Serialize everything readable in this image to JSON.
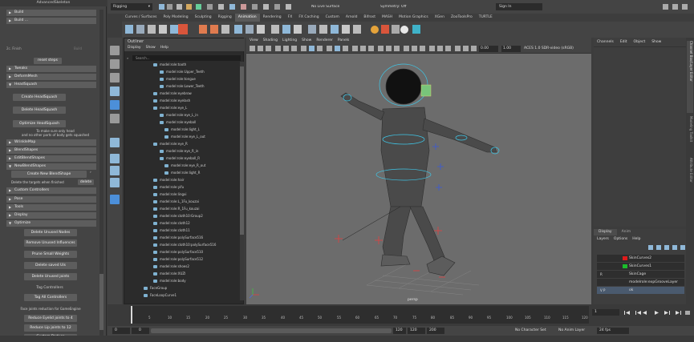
{
  "app": {
    "panel_title": "AdvancedSkeleton"
  },
  "left_panel": {
    "header_sections": [
      "Build",
      "Build ..."
    ],
    "fit_label": "2c. Finish",
    "build_label": "Build",
    "reset_steps": "reset steps",
    "sections": [
      "Tweaks",
      "DeformMesh",
      "HeadSquash"
    ],
    "head_buttons": [
      "Create HeadSquash",
      "Delete HeadSquash",
      "Optimize HeadSquash"
    ],
    "head_note_1": "To make sure only head",
    "head_note_2": "and no other parts of body gets squashed",
    "sections_2": [
      "WrinkleMap",
      "BlendShapes",
      "EditBlendShapes",
      "NewBlendShapes"
    ],
    "new_blendshape_button": "Create New BlendShape",
    "delete_targets_label": "Delete the targets when finished",
    "delete_btn": "delete",
    "custom_controllers": "Custom Controllers",
    "sections_3": [
      "Pose",
      "Tools",
      "Display",
      "Optimize"
    ],
    "optimize_buttons": [
      "Delete Unused Nodes",
      "Remove Unused Influences",
      "Prune Small Weights",
      "Delete saved UIs",
      "Delete Unused joints"
    ],
    "tag_controllers_label": "Tag Controllers",
    "tag_all_button": "Tag All Controllers",
    "reduce_label": "Face joints reduction for GameEngine",
    "reduce_buttons": [
      "Reduce Eyelid joints to 4",
      "Reduce Lip joints to 12",
      "Custom Reduce"
    ]
  },
  "topbar": {
    "workspace": "Rigging",
    "live_surface": "No Live Surface",
    "symmetry": "Symmetry: Off",
    "sign_in": "Sign In"
  },
  "shelf_tabs": [
    "Curves / Surfaces",
    "Poly Modeling",
    "Sculpting",
    "Rigging",
    "Animation",
    "Rendering",
    "FX",
    "FX Caching",
    "Custom",
    "Arnold",
    "Bifrost",
    "MASH",
    "Motion Graphics",
    "XGen",
    "ZooToolsPro",
    "TURTLE"
  ],
  "shelf_active": "Animation",
  "outliner": {
    "title": "Outliner",
    "menus": [
      "Display",
      "Show",
      "Help"
    ],
    "search_placeholder": "Search...",
    "items": [
      "model:role:tooth",
      "model:role:Upper_Teeth",
      "model:role:tongue",
      "model:role:Lower_Teeth",
      "model:role:eyebrow",
      "model:role:eyelash",
      "model:role:eye_L",
      "model:role:eye_L_in",
      "model:role:eyeball",
      "model:role:light_L",
      "model:role:eye_L_out",
      "model:role:eye_R",
      "model:role:eye_R_in",
      "model:role:eyeball_R",
      "model:role:eye_R_out",
      "model:role:light_R",
      "model:role:hair",
      "model:role:yifu",
      "model:role:lingxi",
      "model:role:L_1Fu_kouzai",
      "model:role:R_1Fu_kouzai",
      "model:role:cloth10:Group2",
      "model:role:cloth12",
      "model:role:cloth11",
      "model:role:polySurface516",
      "model:role:cloth10:polySurface516",
      "model:role:polySurface510",
      "model:role:polySurface512",
      "model:role:shoes2",
      "model:role:XUZI",
      "model:role:body",
      "FaceGroup",
      "FaceLoopCurve1"
    ]
  },
  "viewport": {
    "menus": [
      "View",
      "Shading",
      "Lighting",
      "Show",
      "Renderer",
      "Panels"
    ],
    "frame_a": "0.00",
    "frame_b": "1.00",
    "color_space": "ACES 1.0 SDR-video (sRGB)",
    "camera_label": "persp"
  },
  "channels": {
    "menus": [
      "Channels",
      "Edit",
      "Object",
      "Show"
    ]
  },
  "side_tabs": [
    "Channel Box/Layer Editor",
    "Modeling Toolkit",
    "Attribute Editor"
  ],
  "layers": {
    "tabs": [
      "Display",
      "Anim"
    ],
    "menus": [
      "Layers",
      "Options",
      "Help"
    ],
    "rows": [
      {
        "name": "SkinCurves2",
        "color": "#e01b1b",
        "flag": ""
      },
      {
        "name": "SkinCurves1",
        "color": "#1bbd2b",
        "flag": ""
      },
      {
        "name": "SkinCage",
        "color": "",
        "flag": "R"
      },
      {
        "name": "modelrole:expGrooveLayer",
        "color": "",
        "flag": ""
      },
      {
        "name": "ok",
        "color": "",
        "flag": "V P"
      }
    ]
  },
  "timeline": {
    "ticks": [
      "5",
      "10",
      "15",
      "20",
      "25",
      "30",
      "35",
      "40",
      "45",
      "50",
      "55",
      "60",
      "65",
      "70",
      "75",
      "80",
      "85",
      "90",
      "95",
      "100",
      "105",
      "110",
      "115",
      "120"
    ],
    "current_frame": "1"
  },
  "range": {
    "start": "0",
    "inner_start": "0",
    "end_a": "120",
    "end_b": "120",
    "end_c": "200",
    "character_set": "No Character Set",
    "anim_layer": "No Anim Layer",
    "fps": "24 fps"
  }
}
